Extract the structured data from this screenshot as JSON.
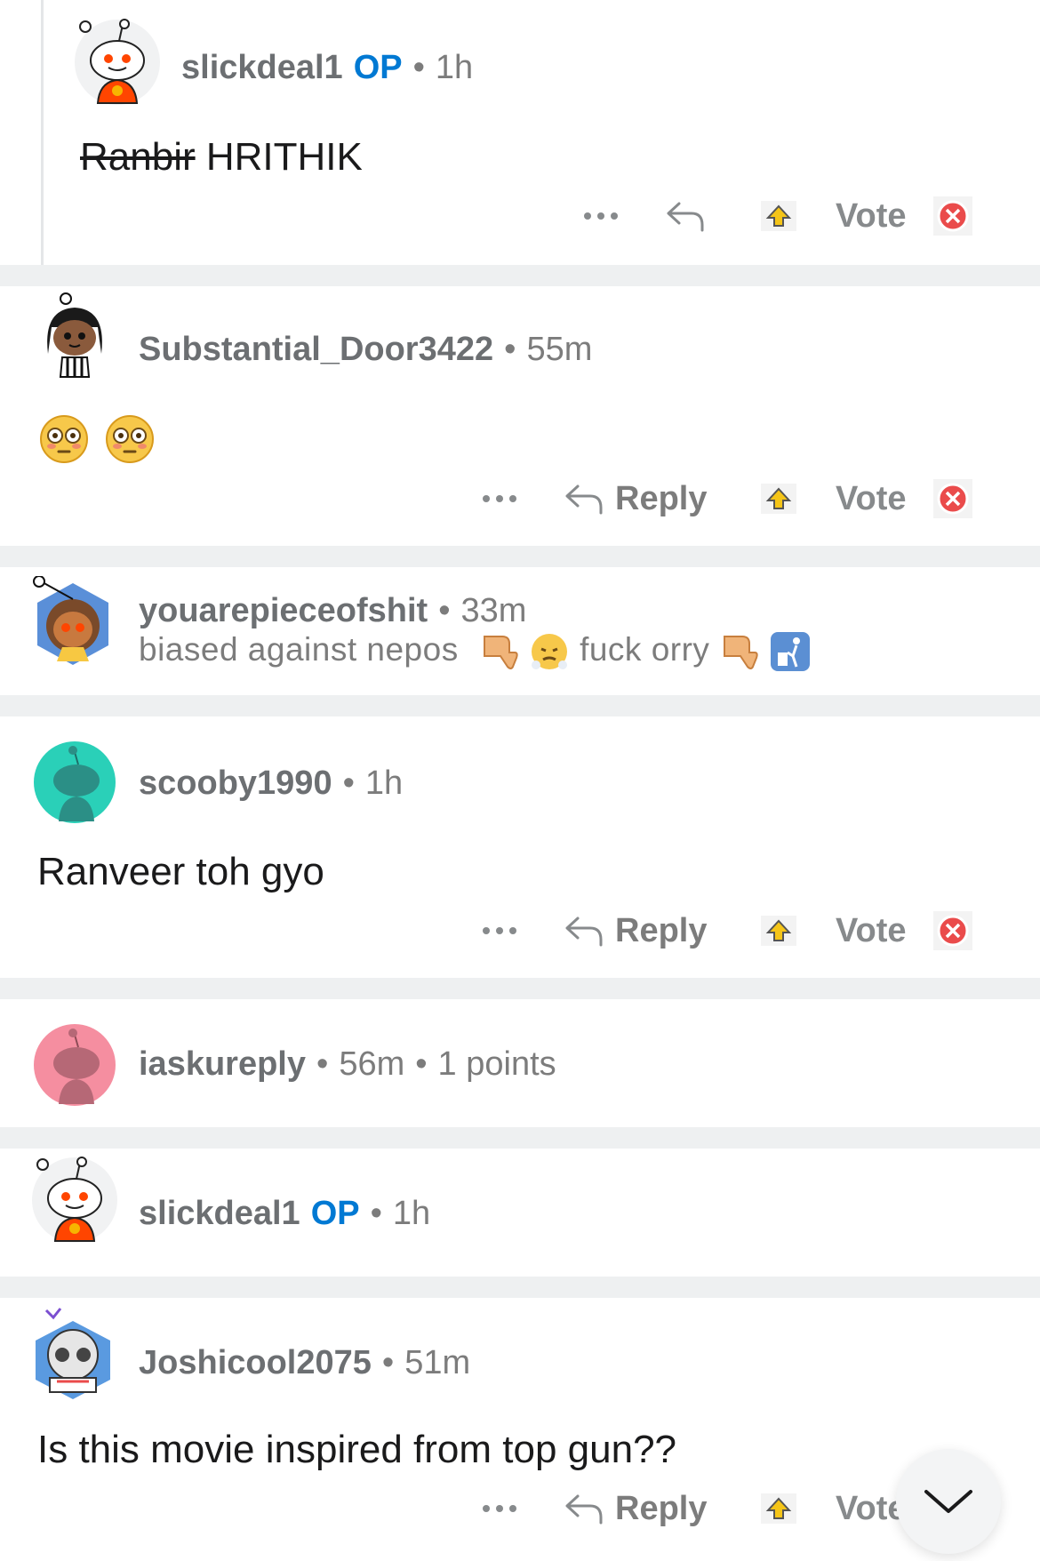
{
  "comments": [
    {
      "username": "slickdeal1",
      "op_badge": "OP",
      "time": "1h",
      "body_strike": "Ranbir",
      "body_rest": "HRITHIK",
      "vote_label": "Vote"
    },
    {
      "username": "Substantial_Door3422",
      "time": "55m",
      "body_emoji": "flushed-face x2",
      "reply_label": "Reply",
      "vote_label": "Vote"
    },
    {
      "username": "youarepieceofshit",
      "time": "33m",
      "flair_part1": "biased against nepos",
      "flair_part2": "fuck orry"
    },
    {
      "username": "scooby1990",
      "time": "1h",
      "body": "Ranveer toh gyo",
      "reply_label": "Reply",
      "vote_label": "Vote"
    },
    {
      "username": "iaskureply",
      "time": "56m",
      "points": "1 points"
    },
    {
      "username": "slickdeal1",
      "op_badge": "OP",
      "time": "1h"
    },
    {
      "username": "Joshicool2075",
      "time": "51m",
      "body": "Is this movie inspired from top gun??",
      "reply_label": "Reply",
      "vote_label": "Vote"
    }
  ],
  "icons": {
    "more": "more-options-icon",
    "reply": "reply-arrow-icon",
    "upvote": "upvote-icon",
    "downvote": "downvote-icon",
    "scroll": "chevron-down-icon"
  },
  "colors": {
    "op": "#0079d3",
    "upvote": "#f5c518",
    "downvote": "#ea4b4b",
    "separator": "#eef0f1"
  }
}
